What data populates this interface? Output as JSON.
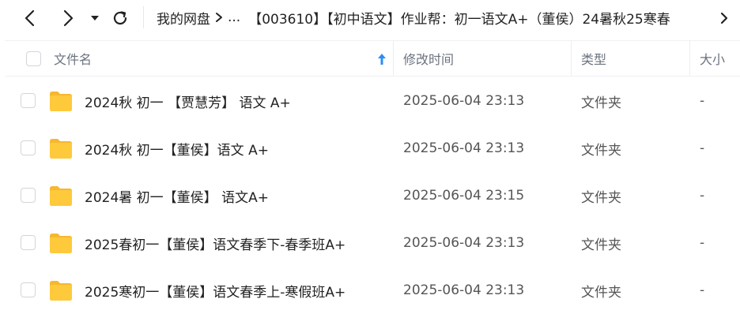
{
  "toolbar": {
    "back_icon": "chevron-left-icon",
    "forward_icon": "chevron-right-icon",
    "history_icon": "caret-down-icon",
    "refresh_icon": "refresh-icon"
  },
  "breadcrumb": {
    "items": [
      "我的网盘",
      "...",
      "【003610】【初中语文】作业帮：初一语文A+（董侯）24暑秋25寒春"
    ]
  },
  "columns": {
    "name": "文件名",
    "modified": "修改时间",
    "type": "类型",
    "size": "大小"
  },
  "colors": {
    "folder": "#FFC93C",
    "sort_arrow": "#2F8CF6"
  },
  "files": [
    {
      "name": "2024秋 初一 【贾慧芳】 语文 A+",
      "modified": "2025-06-04 23:13",
      "type": "文件夹",
      "size": "-"
    },
    {
      "name": "2024秋 初一【董侯】语文 A+",
      "modified": "2025-06-04 23:13",
      "type": "文件夹",
      "size": "-"
    },
    {
      "name": "2024暑 初一【董侯】 语文A+",
      "modified": "2025-06-04 23:15",
      "type": "文件夹",
      "size": "-"
    },
    {
      "name": "2025春初一【董侯】语文春季下-春季班A+",
      "modified": "2025-06-04 23:13",
      "type": "文件夹",
      "size": "-"
    },
    {
      "name": "2025寒初一【董侯】语文春季上-寒假班A+",
      "modified": "2025-06-04 23:13",
      "type": "文件夹",
      "size": "-"
    }
  ]
}
